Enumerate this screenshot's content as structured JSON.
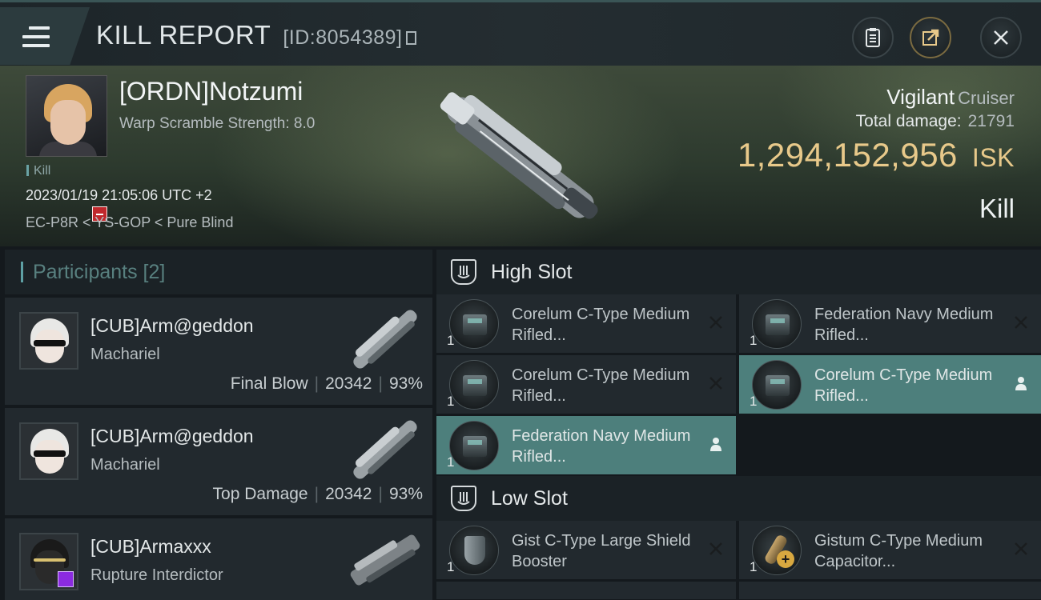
{
  "header": {
    "title": "KILL REPORT",
    "report_id": "[ID:8054389]"
  },
  "victim": {
    "name": "[ORDN]Notzumi",
    "stat": "Warp Scramble Strength: 8.0",
    "tag": "Kill",
    "datetime": "2023/01/19 21:05:06 UTC +2",
    "location": "EC-P8R < YS-GOP < Pure Blind",
    "ship_name": "Vigilant",
    "ship_class": "Cruiser",
    "total_damage_label": "Total damage:",
    "total_damage": "21791",
    "isk_value": "1,294,152,956",
    "isk_unit": "ISK",
    "result": "Kill"
  },
  "participants": {
    "title": "Participants [2]",
    "items": [
      {
        "name": "[CUB]Arm@geddon",
        "ship": "Machariel",
        "role": "Final Blow",
        "damage": "20342",
        "percent": "93%"
      },
      {
        "name": "[CUB]Arm@geddon",
        "ship": "Machariel",
        "role": "Top Damage",
        "damage": "20342",
        "percent": "93%"
      },
      {
        "name": "[CUB]Armaxxx",
        "ship": "Rupture Interdictor"
      }
    ]
  },
  "high_slot": {
    "title": "High Slot",
    "modules": [
      {
        "name": "Corelum C-Type Medium Rifled...",
        "qty": "1",
        "status": "destroyed"
      },
      {
        "name": "Federation Navy Medium Rifled...",
        "qty": "1",
        "status": "destroyed"
      },
      {
        "name": "Corelum C-Type Medium Rifled...",
        "qty": "1",
        "status": "destroyed"
      },
      {
        "name": "Corelum C-Type Medium Rifled...",
        "qty": "1",
        "status": "dropped"
      },
      {
        "name": "Federation Navy Medium Rifled...",
        "qty": "1",
        "status": "dropped"
      }
    ]
  },
  "low_slot": {
    "title": "Low Slot",
    "modules": [
      {
        "name": "Gist C-Type Large Shield Booster",
        "qty": "1",
        "status": "destroyed"
      },
      {
        "name": "Gistum C-Type Medium Capacitor...",
        "qty": "1",
        "status": "destroyed"
      }
    ]
  },
  "icons": {
    "menu": "menu-icon",
    "clipboard": "clipboard-icon",
    "share": "share-icon",
    "close": "close-icon",
    "destroyed": "x-icon",
    "dropped": "person-icon",
    "slot": "high-slot-icon"
  },
  "colors": {
    "isk": "#e8c98a",
    "dropped_bg": "#4d7f7c",
    "participants_title": "#58807f"
  }
}
